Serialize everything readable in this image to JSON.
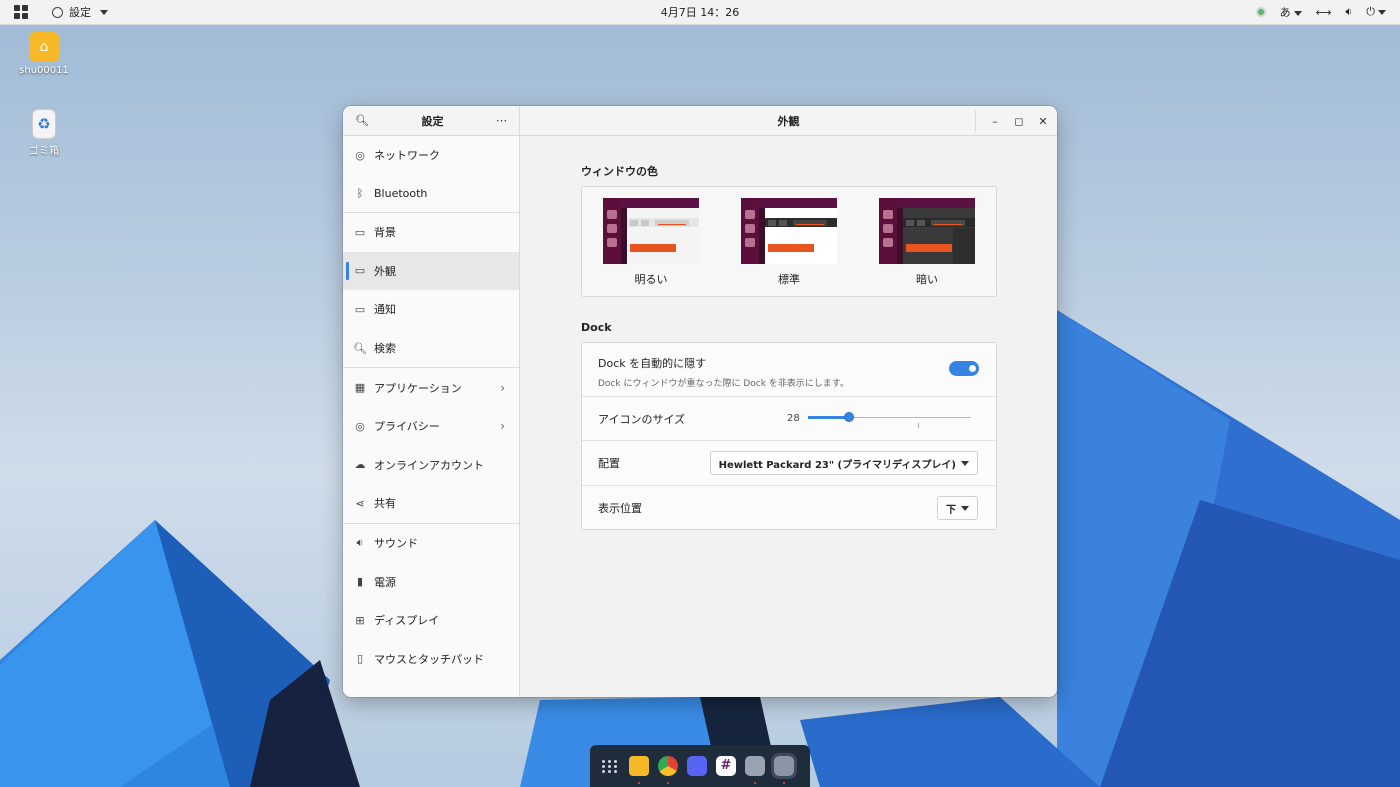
{
  "topbar": {
    "app_name": "設定",
    "clock": "4月7日  14：26",
    "input_method": "あ"
  },
  "desktop": {
    "icons": [
      {
        "label": "shu00011"
      },
      {
        "label": "ゴミ箱"
      }
    ]
  },
  "window": {
    "sidebar_title": "設定",
    "main_title": "外観",
    "sidebar_items": [
      {
        "label": "ネットワーク",
        "icon": "network-icon"
      },
      {
        "label": "Bluetooth",
        "icon": "bluetooth-icon"
      },
      {
        "label": "背景",
        "icon": "background-icon"
      },
      {
        "label": "外観",
        "icon": "appearance-icon",
        "active": true
      },
      {
        "label": "通知",
        "icon": "notification-icon"
      },
      {
        "label": "検索",
        "icon": "search-icon"
      },
      {
        "label": "アプリケーション",
        "icon": "apps-icon",
        "chevron": true
      },
      {
        "label": "プライバシー",
        "icon": "privacy-icon",
        "chevron": true
      },
      {
        "label": "オンラインアカウント",
        "icon": "cloud-icon"
      },
      {
        "label": "共有",
        "icon": "share-icon"
      },
      {
        "label": "サウンド",
        "icon": "speaker-icon"
      },
      {
        "label": "電源",
        "icon": "battery-icon"
      },
      {
        "label": "ディスプレイ",
        "icon": "display-icon"
      },
      {
        "label": "マウスとタッチパッド",
        "icon": "mouse-icon"
      }
    ]
  },
  "appearance": {
    "window_color_title": "ウィンドウの色",
    "themes": [
      {
        "label": "明るい"
      },
      {
        "label": "標準"
      },
      {
        "label": "暗い"
      }
    ],
    "dock_title": "Dock",
    "autohide_label": "Dock を自動的に隠す",
    "autohide_sub": "Dock にウィンドウが重なった際に Dock を非表示にします。",
    "autohide_on": true,
    "icon_size_label": "アイコンのサイズ",
    "icon_size_value": "28",
    "icon_size_fraction": 0.25,
    "placement_label": "配置",
    "placement_value": "Hewlett Packard 23\" (プライマリディスプレイ)",
    "position_label": "表示位置",
    "position_value": "下"
  },
  "colors": {
    "accent": "#3584e4",
    "ubuntu_orange": "#e95420"
  }
}
